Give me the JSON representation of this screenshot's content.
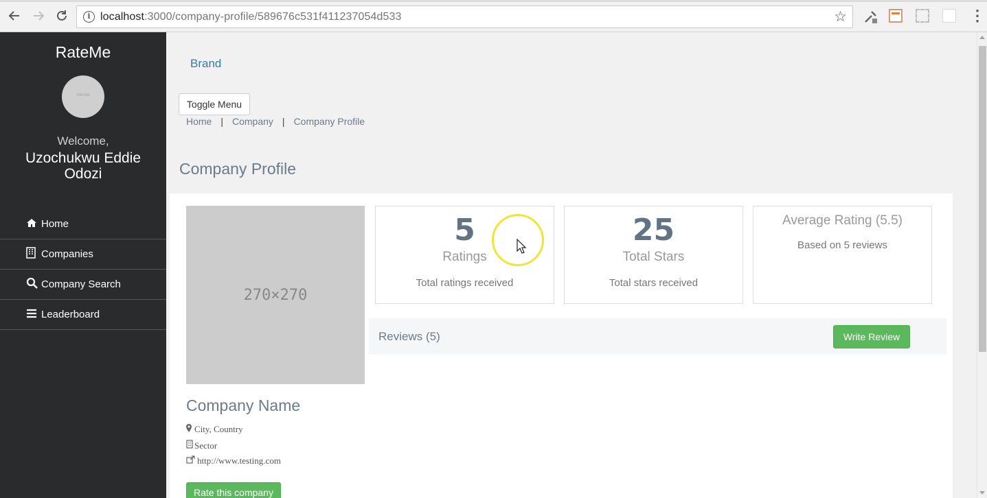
{
  "browser": {
    "url_host": "localhost",
    "url_rest": ":3000/company-profile/589676c531f411237054d533",
    "back_icon": "arrow-left-icon",
    "forward_icon": "arrow-right-icon",
    "reload_icon": "reload-icon",
    "bookmark_icon": "star-icon"
  },
  "sidebar": {
    "app_name": "RateMe",
    "avatar_placeholder": "150×150",
    "welcome": "Welcome,",
    "user_name": "Uzochukwu Eddie Odozi",
    "items": [
      {
        "label": "Home",
        "icon": "home-icon"
      },
      {
        "label": "Companies",
        "icon": "building-icon"
      },
      {
        "label": "Company Search",
        "icon": "search-icon"
      },
      {
        "label": "Leaderboard",
        "icon": "bars-icon"
      }
    ]
  },
  "header": {
    "brand": "Brand",
    "toggle_label": "Toggle Menu",
    "breadcrumb": [
      "Home",
      "Company",
      "Company Profile"
    ],
    "breadcrumb_sep": "|",
    "page_title": "Company Profile"
  },
  "company": {
    "image_placeholder": "270×270",
    "name": "Company Name",
    "location": "City, Country",
    "sector": "Sector",
    "website": "http://www.testing.com",
    "rate_label": "Rate this company"
  },
  "stats": {
    "ratings_value": "5",
    "ratings_label": "Ratings",
    "ratings_sub": "Total ratings received",
    "stars_value": "25",
    "stars_label": "Total Stars",
    "stars_sub": "Total stars received",
    "average_label": "Average Rating (5.5)",
    "average_sub": "Based on 5 reviews"
  },
  "reviews": {
    "title": "Reviews (5)",
    "write_label": "Write Review"
  },
  "colors": {
    "sidebar_bg": "#2a2b2c",
    "accent_green": "#5cb85c",
    "link_blue": "#337ab7",
    "muted_text": "#6a7b8c"
  }
}
